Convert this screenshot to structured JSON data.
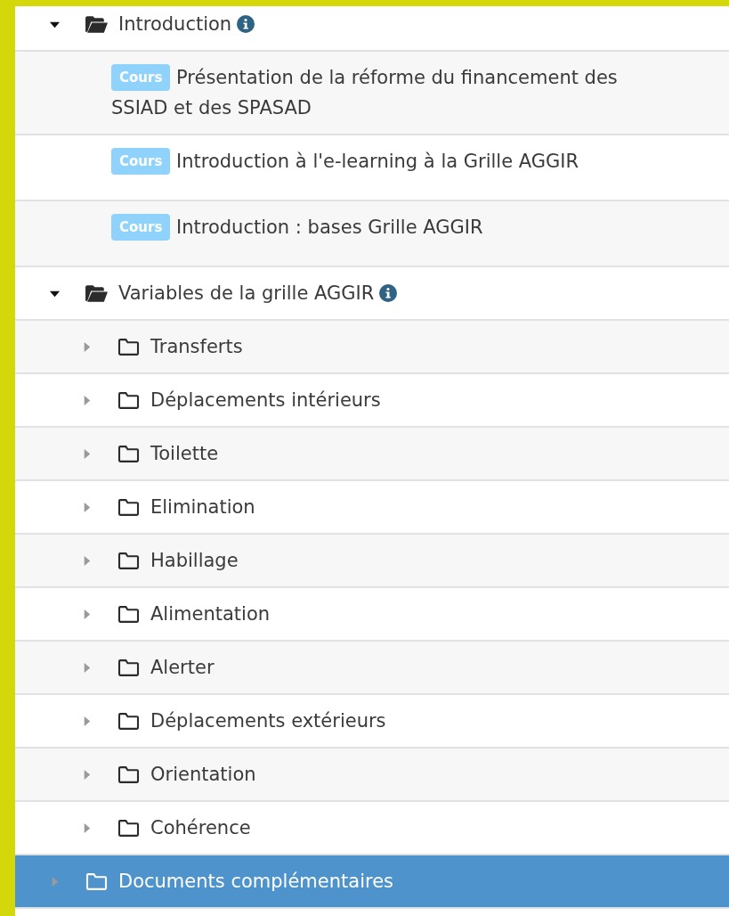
{
  "tree": [
    {
      "kind": "folder",
      "label": "Introduction",
      "info": true,
      "expanded": true,
      "selected": false,
      "children": [
        {
          "kind": "course",
          "badge": "Cours",
          "label": "Présentation de la réforme du financement des SSIAD et des SPASAD"
        },
        {
          "kind": "course",
          "badge": "Cours",
          "label": "Introduction à l'e-learning à la Grille AGGIR"
        },
        {
          "kind": "course",
          "badge": "Cours",
          "label": "Introduction : bases Grille AGGIR"
        }
      ]
    },
    {
      "kind": "folder",
      "label": "Variables de la grille AGGIR",
      "info": true,
      "expanded": true,
      "selected": false,
      "children": [
        {
          "kind": "folder",
          "label": "Transferts",
          "info": false,
          "expanded": false,
          "selected": false
        },
        {
          "kind": "folder",
          "label": "Déplacements intérieurs",
          "info": false,
          "expanded": false,
          "selected": false
        },
        {
          "kind": "folder",
          "label": "Toilette",
          "info": false,
          "expanded": false,
          "selected": false
        },
        {
          "kind": "folder",
          "label": "Elimination",
          "info": false,
          "expanded": false,
          "selected": false
        },
        {
          "kind": "folder",
          "label": "Habillage",
          "info": false,
          "expanded": false,
          "selected": false
        },
        {
          "kind": "folder",
          "label": "Alimentation",
          "info": false,
          "expanded": false,
          "selected": false
        },
        {
          "kind": "folder",
          "label": "Alerter",
          "info": false,
          "expanded": false,
          "selected": false
        },
        {
          "kind": "folder",
          "label": "Déplacements extérieurs",
          "info": false,
          "expanded": false,
          "selected": false
        },
        {
          "kind": "folder",
          "label": "Orientation",
          "info": false,
          "expanded": false,
          "selected": false
        },
        {
          "kind": "folder",
          "label": "Cohérence",
          "info": false,
          "expanded": false,
          "selected": false
        }
      ]
    },
    {
      "kind": "folder",
      "label": "Documents complémentaires",
      "info": false,
      "expanded": false,
      "selected": true
    }
  ]
}
